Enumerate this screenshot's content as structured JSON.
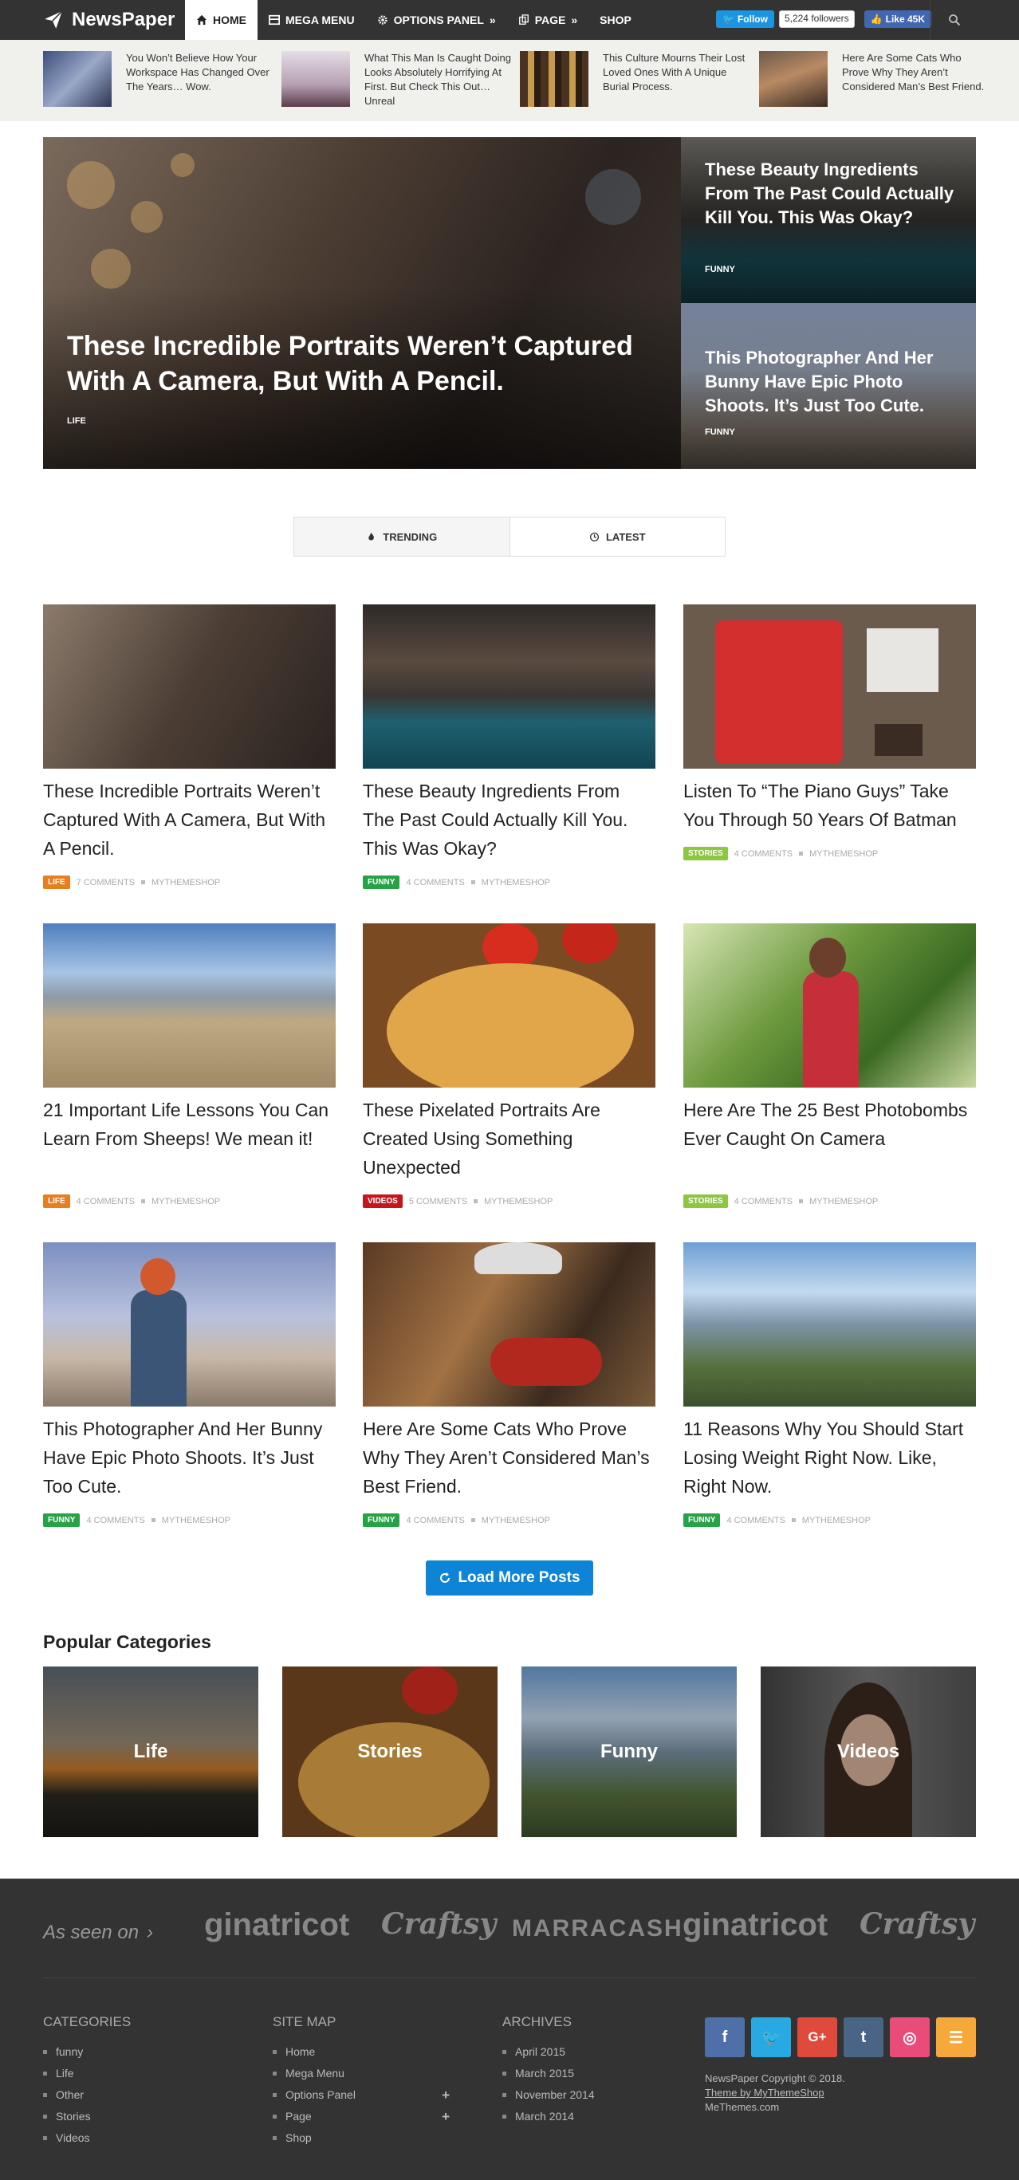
{
  "header": {
    "logo": "NewsPaper",
    "nav": [
      {
        "label": "HOME",
        "icon": "home-icon"
      },
      {
        "label": "MEGA MENU",
        "icon": "grid-icon"
      },
      {
        "label": "OPTIONS PANEL",
        "icon": "gear-icon"
      },
      {
        "label": "PAGE",
        "icon": "copy-icon"
      },
      {
        "label": "SHOP"
      }
    ],
    "twitter_follow": "Follow",
    "twitter_count": "5,224 followers",
    "facebook_like": "Like 45K"
  },
  "ticker": [
    {
      "text": "You Won’t Believe How Your Workspace Has Changed Over The Years… Wow."
    },
    {
      "text": "What This Man Is Caught Doing Looks Absolutely Horrifying At First. But Check This Out… Unreal"
    },
    {
      "text": "This Culture Mourns Their Lost Loved Ones With A Unique Burial Process."
    },
    {
      "text": "Here Are Some Cats Who Prove Why They Aren’t Considered Man’s Best Friend."
    }
  ],
  "hero": {
    "main": {
      "title": "These Incredible Portraits Weren’t Captured With A Camera, But With A Pencil.",
      "category": "LIFE"
    },
    "side": [
      {
        "title": "These Beauty Ingredients From The Past Could Actually Kill You. This Was Okay?",
        "category": "FUNNY"
      },
      {
        "title": "This Photographer And Her Bunny Have Epic Photo Shoots. It’s Just Too Cute.",
        "category": "FUNNY"
      }
    ]
  },
  "tabs": [
    {
      "label": "TRENDING",
      "icon": "fire-icon"
    },
    {
      "label": "LATEST",
      "icon": "clock-icon"
    }
  ],
  "posts": [
    {
      "title": "These Incredible Portraits Weren’t Captured With A Camera, But With A Pencil.",
      "category": "LIFE",
      "comments": "7 COMMENTS",
      "author": "MYTHEMESHOP"
    },
    {
      "title": "These Beauty Ingredients From The Past Could Actually Kill You. This Was Okay?",
      "category": "FUNNY",
      "comments": "4 COMMENTS",
      "author": "MYTHEMESHOP"
    },
    {
      "title": "Listen To “The Piano Guys” Take You Through 50 Years Of Batman",
      "category": "STORIES",
      "comments": "4 COMMENTS",
      "author": "MYTHEMESHOP"
    },
    {
      "title": "21 Important Life Lessons You Can Learn From Sheeps! We mean it!",
      "category": "LIFE",
      "comments": "4 COMMENTS",
      "author": "MYTHEMESHOP"
    },
    {
      "title": "These Pixelated Portraits Are Created Using Something Unexpected",
      "category": "VIDEOS",
      "comments": "5 COMMENTS",
      "author": "MYTHEMESHOP"
    },
    {
      "title": "Here Are The 25 Best Photobombs Ever Caught On Camera",
      "category": "STORIES",
      "comments": "4 COMMENTS",
      "author": "MYTHEMESHOP"
    },
    {
      "title": "This Photographer And Her Bunny Have Epic Photo Shoots. It’s Just Too Cute.",
      "category": "FUNNY",
      "comments": "4 COMMENTS",
      "author": "MYTHEMESHOP"
    },
    {
      "title": "Here Are Some Cats Who Prove Why They Aren’t Considered Man’s Best Friend.",
      "category": "FUNNY",
      "comments": "4 COMMENTS",
      "author": "MYTHEMESHOP"
    },
    {
      "title": "11 Reasons Why You Should Start Losing Weight Right Now. Like, Right Now.",
      "category": "FUNNY",
      "comments": "4 COMMENTS",
      "author": "MYTHEMESHOP"
    }
  ],
  "colors": {
    "life": "#e67e22",
    "funny": "#27a347",
    "stories": "#8dc63f",
    "videos": "#c4161c",
    "accent": "#0e84d6"
  },
  "load_more": "Load More Posts",
  "popular": {
    "title": "Popular Categories",
    "items": [
      "Life",
      "Stories",
      "Funny",
      "Videos"
    ]
  },
  "footer": {
    "as_seen_on": "As seen on",
    "brands": [
      "ginatricot",
      "Craftsy",
      "MARRACASH",
      "ginatricot",
      "Craftsy"
    ],
    "categories": {
      "title": "CATEGORIES",
      "items": [
        "funny",
        "Life",
        "Other",
        "Stories",
        "Videos"
      ]
    },
    "sitemap": {
      "title": "SITE MAP",
      "items": [
        "Home",
        "Mega Menu",
        "Options Panel",
        "Page",
        "Shop"
      ]
    },
    "archives": {
      "title": "ARCHIVES",
      "items": [
        "April 2015",
        "March 2015",
        "November 2014",
        "March 2014"
      ]
    },
    "copyright": "NewsPaper Copyright © 2018.",
    "theme_by": "Theme by MyThemeShop",
    "site": "MeThemes.com"
  }
}
